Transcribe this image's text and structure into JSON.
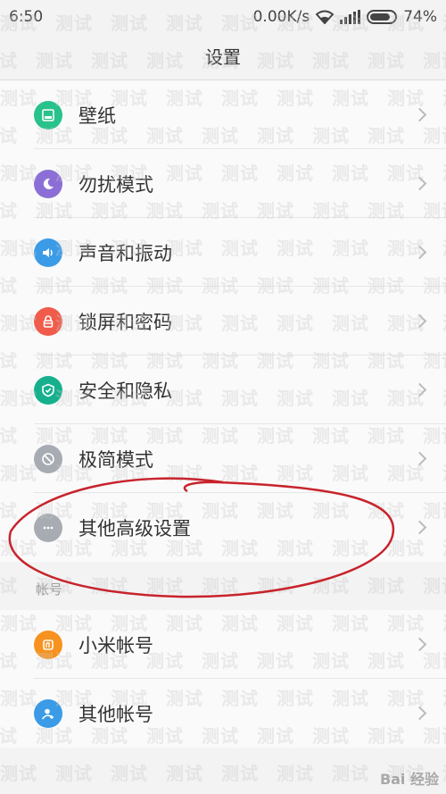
{
  "status_bar": {
    "time": "6:50",
    "network_speed": "0.00K/s",
    "battery": "74%",
    "battery_level": 0.74
  },
  "title": "设置",
  "groups": [
    {
      "items": [
        {
          "label": "壁纸",
          "icon": "wallpaper-icon",
          "color": "#28c28a"
        },
        {
          "label": "勿扰模式",
          "icon": "moon-icon",
          "color": "#8c6fd6"
        },
        {
          "label": "声音和振动",
          "icon": "speaker-icon",
          "color": "#3b9be6"
        },
        {
          "label": "锁屏和密码",
          "icon": "lock-icon",
          "color": "#f05b4a"
        },
        {
          "label": "安全和隐私",
          "icon": "shield-icon",
          "color": "#16b08d"
        },
        {
          "label": "极简模式",
          "icon": "simple-mode-icon",
          "color": "#a7acb2"
        },
        {
          "label": "其他高级设置",
          "icon": "more-icon",
          "color": "#a7acb2"
        }
      ]
    }
  ],
  "account_section": {
    "header": "帐号",
    "items": [
      {
        "label": "小米帐号",
        "icon": "mi-account-icon",
        "color": "#f7921e"
      },
      {
        "label": "其他帐号",
        "icon": "person-icon",
        "color": "#3b9be6"
      }
    ]
  },
  "watermark_text": "测试",
  "brand_mark": "Bai 经验",
  "annotation_color": "#c8232c"
}
